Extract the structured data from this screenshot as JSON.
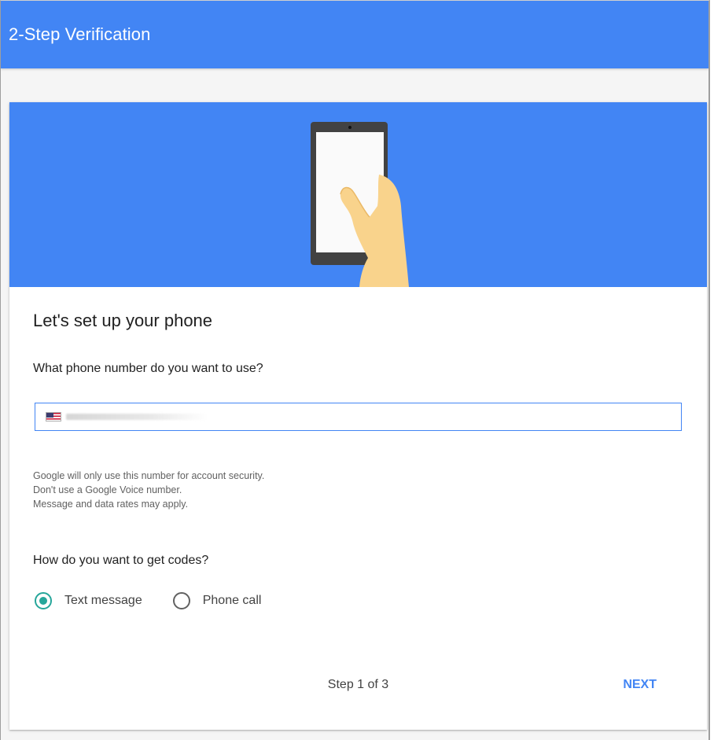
{
  "app_bar": {
    "title": "2-Step Verification"
  },
  "card": {
    "hero_illustration": "hand-holding-phone-illustration",
    "title": "Let's set up your phone",
    "phone_question": "What phone number do you want to use?",
    "phone_field": {
      "country_flag": "us-flag-icon",
      "value": ""
    },
    "disclaimer": [
      "Google will only use this number for account security.",
      "Don't use a Google Voice number.",
      "Message and data rates may apply."
    ],
    "codes_question": "How do you want to get codes?",
    "delivery_options": [
      {
        "label": "Text message",
        "selected": true
      },
      {
        "label": "Phone call",
        "selected": false
      }
    ],
    "step_text": "Step 1 of 3",
    "next_label": "NEXT"
  },
  "colors": {
    "brand_blue": "#4285f4",
    "radio_selected": "#26a69a",
    "skin": "#f9d38c"
  }
}
